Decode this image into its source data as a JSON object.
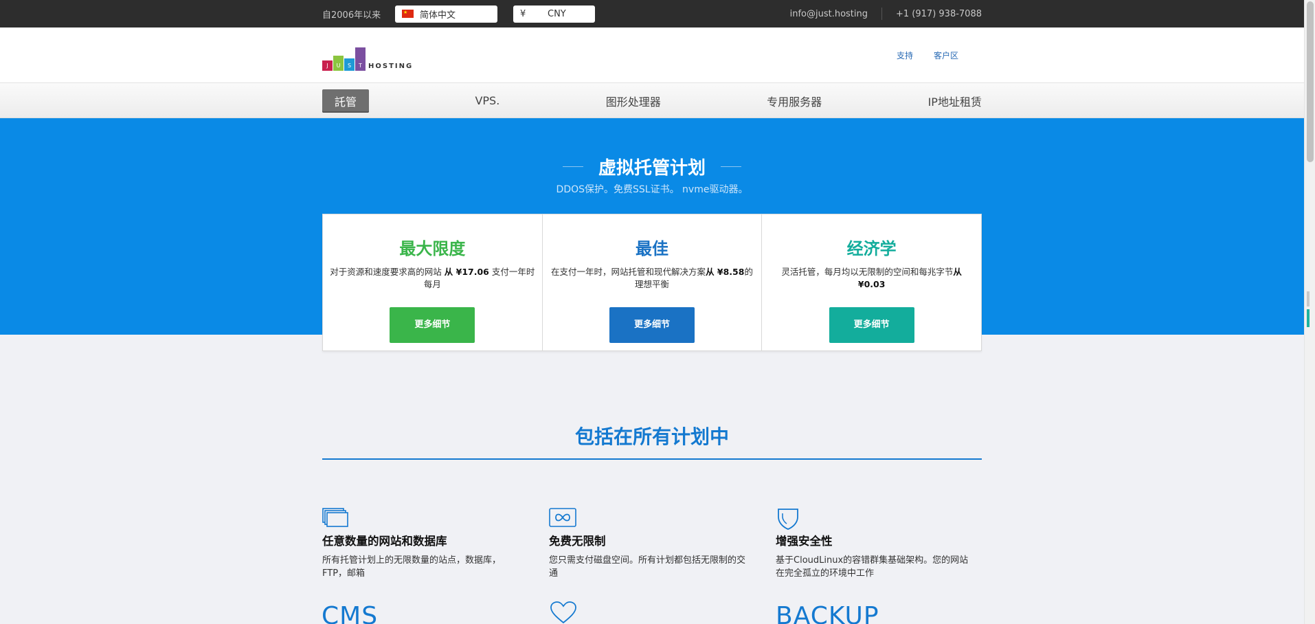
{
  "topbar": {
    "since": "自2006年以来",
    "language": "简体中文",
    "currency_symbol": "¥",
    "currency": "CNY",
    "email": "info@just.hosting",
    "phone": "+1 (917) 938-7088"
  },
  "header": {
    "logo_letters": [
      "J",
      "U",
      "S",
      "T"
    ],
    "logo_text": "HOSTING",
    "links": [
      "支持",
      "客户区"
    ]
  },
  "nav": [
    "託管",
    "VPS.",
    "图形处理器",
    "专用服务器",
    "IP地址租赁"
  ],
  "hero": {
    "title": "虚拟托管计划",
    "subtitle": "DDOS保护。免费SSL证书。 nvme驱动器。"
  },
  "plans": [
    {
      "name": "最大限度",
      "desc_pre": "对于资源和速度要求高的网站 ",
      "desc_bold": "从 ¥17.06",
      "desc_post": " 支付一年时每月",
      "button": "更多细节",
      "color": "#3ab54a"
    },
    {
      "name": "最佳",
      "desc_pre": "在支付一年时，网站托管和现代解决方案",
      "desc_bold": "从 ¥8.58",
      "desc_post": "的理想平衡",
      "button": "更多细节",
      "color": "#1a72c4"
    },
    {
      "name": "经济学",
      "desc_pre": "灵活托管，每月均以无限制的空间和每兆字节",
      "desc_bold": "从 ¥0.03",
      "desc_post": "",
      "button": "更多细节",
      "color": "#13ad9c"
    }
  ],
  "included": {
    "title": "包括在所有计划中",
    "features": [
      {
        "icon": "monitors-icon",
        "title": "任意数量的网站和数据库",
        "desc": "所有托管计划上的无限数量的站点，数据库，FTP，邮箱"
      },
      {
        "icon": "infinity-icon",
        "title": "免费无限制",
        "desc": "您只需支付磁盘空间。所有计划都包括无限制的交通"
      },
      {
        "icon": "shield-icon",
        "title": "增强安全性",
        "desc": "基于CloudLinux的容错群集基础架构。您的网站在完全孤立的环境中工作"
      }
    ],
    "next_row": [
      "CMS",
      "BACKUP"
    ]
  }
}
